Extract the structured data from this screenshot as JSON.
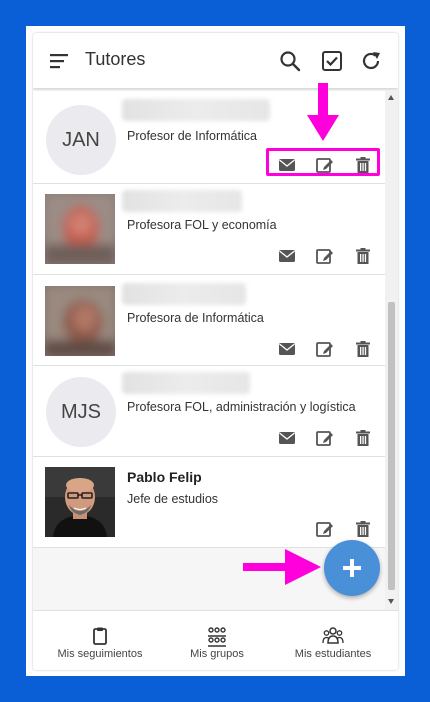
{
  "header": {
    "title": "Tutores"
  },
  "tutors": [
    {
      "initials": "JAN",
      "description": "Profesor de Informática"
    },
    {
      "description": "Profesora FOL y economía"
    },
    {
      "description": "Profesora de Informática"
    },
    {
      "initials": "MJS",
      "description": "Profesora FOL, administración y logística"
    },
    {
      "name": "Pablo Felip",
      "description": "Jefe de estudios"
    }
  ],
  "bottom_nav": {
    "items": [
      {
        "label": "Mis seguimientos",
        "icon": "clipboard-icon"
      },
      {
        "label": "Mis grupos",
        "icon": "groups-icon"
      },
      {
        "label": "Mis estudiantes",
        "icon": "students-icon"
      }
    ]
  },
  "colors": {
    "background": "#0a5fd6",
    "highlight": "#ff00dd",
    "fab": "#4a90d9"
  }
}
